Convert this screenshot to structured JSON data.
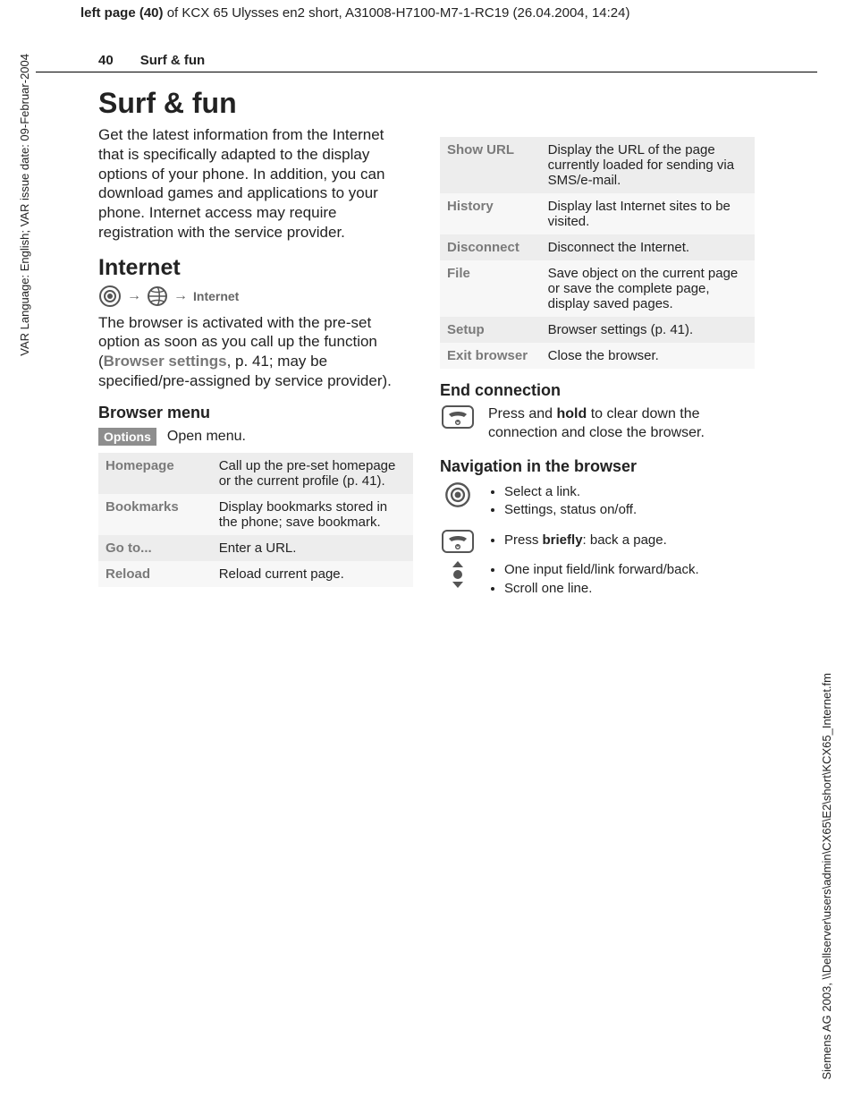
{
  "meta": {
    "top_line_bold": "left page (40)",
    "top_line_rest": " of KCX 65 Ulysses en2 short, A31008-H7100-M7-1-RC19 (26.04.2004, 14:24)",
    "side_left": "VAR Language: English; VAR issue date: 09-Februar-2004",
    "side_right": "Siemens AG 2003, \\\\Dellserver\\users\\admin\\CX65\\E2\\short\\KCX65_Internet.fm"
  },
  "header": {
    "page_number": "40",
    "running_title": "Surf & fun"
  },
  "left": {
    "title": "Surf & fun",
    "intro": "Get the latest information from the Internet that is specifically adapted to the display options of your phone. In addition, you can download games and applications to your phone. Internet access may require registration with the service provider.",
    "internet_heading": "Internet",
    "nav_path_label": "Internet",
    "browser_para_pre": "The browser is activated with the pre-set option as soon as you call up the function (",
    "browser_para_link": "Browser settings",
    "browser_para_post": ", p. 41; may be specified/pre-assigned by service provider).",
    "browser_menu_heading": "Browser menu",
    "options_btn": "Options",
    "options_text": "Open menu.",
    "menu1": [
      {
        "k": "Homepage",
        "v": "Call up the pre-set homepage or the current profile (p. 41)."
      },
      {
        "k": "Bookmarks",
        "v": "Display bookmarks stored in the phone; save bookmark."
      },
      {
        "k": "Go to...",
        "v": "Enter a URL."
      },
      {
        "k": "Reload",
        "v": "Reload current page."
      }
    ]
  },
  "right": {
    "menu2": [
      {
        "k": "Show URL",
        "v": "Display the URL of the page currently loaded for sending via SMS/e-mail."
      },
      {
        "k": "History",
        "v": "Display last Internet sites to be visited."
      },
      {
        "k": "Disconnect",
        "v": "Disconnect the Internet."
      },
      {
        "k": "File",
        "v": "Save object on the current page or save the complete page, display saved pages."
      },
      {
        "k": "Setup",
        "v": "Browser settings (p. 41)."
      },
      {
        "k": "Exit browser",
        "v": "Close the browser."
      }
    ],
    "end_heading": "End connection",
    "end_text_pre": "Press and ",
    "end_text_bold": "hold",
    "end_text_post": " to clear down the connection and close the browser.",
    "nav_heading": "Navigation in the browser",
    "nav_group1": [
      "Select a link.",
      "Settings, status on/off."
    ],
    "nav_group2_pre": "Press ",
    "nav_group2_bold": "briefly",
    "nav_group2_post": ": back a page.",
    "nav_group3": [
      "One input field/link forward/back.",
      "Scroll one line."
    ]
  }
}
